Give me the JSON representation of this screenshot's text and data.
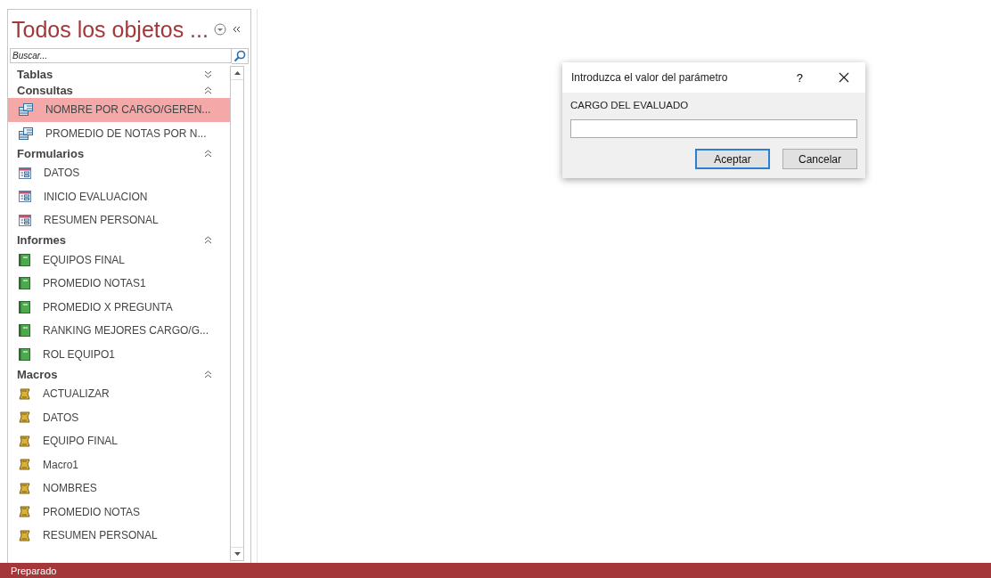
{
  "nav_pane": {
    "title": "Todos los objetos ...",
    "search": {
      "placeholder": "Buscar..."
    },
    "groups": [
      {
        "label": "Tablas",
        "expanded": false
      },
      {
        "label": "Consultas",
        "expanded": true,
        "items": [
          {
            "label": "NOMBRE POR CARGO/GEREN...",
            "kind": "query",
            "selected": true
          },
          {
            "label": "PROMEDIO DE NOTAS POR N...",
            "kind": "query",
            "selected": false
          }
        ]
      },
      {
        "label": "Formularios",
        "expanded": true,
        "items": [
          {
            "label": "DATOS",
            "kind": "form",
            "selected": false
          },
          {
            "label": "INICIO EVALUACION",
            "kind": "form",
            "selected": false
          },
          {
            "label": "RESUMEN PERSONAL",
            "kind": "form",
            "selected": false
          }
        ]
      },
      {
        "label": "Informes",
        "expanded": true,
        "items": [
          {
            "label": "EQUIPOS FINAL",
            "kind": "report",
            "selected": false
          },
          {
            "label": "PROMEDIO NOTAS1",
            "kind": "report",
            "selected": false
          },
          {
            "label": "PROMEDIO X PREGUNTA",
            "kind": "report",
            "selected": false
          },
          {
            "label": "RANKING MEJORES CARGO/G...",
            "kind": "report",
            "selected": false
          },
          {
            "label": "ROL EQUIPO1",
            "kind": "report",
            "selected": false
          }
        ]
      },
      {
        "label": "Macros",
        "expanded": true,
        "items": [
          {
            "label": "ACTUALIZAR",
            "kind": "macro",
            "selected": false
          },
          {
            "label": "DATOS",
            "kind": "macro",
            "selected": false
          },
          {
            "label": "EQUIPO FINAL",
            "kind": "macro",
            "selected": false
          },
          {
            "label": "Macro1",
            "kind": "macro",
            "selected": false
          },
          {
            "label": "NOMBRES",
            "kind": "macro",
            "selected": false
          },
          {
            "label": "PROMEDIO NOTAS",
            "kind": "macro",
            "selected": false
          },
          {
            "label": "RESUMEN PERSONAL",
            "kind": "macro",
            "selected": false
          }
        ]
      }
    ]
  },
  "dialog": {
    "title": "Introduzca el valor del parámetro",
    "help": "?",
    "prompt": "CARGO DEL EVALUADO",
    "buttons": [
      {
        "label": "Aceptar",
        "default": true
      },
      {
        "label": "Cancelar",
        "default": false
      }
    ]
  },
  "status_bar": {
    "text": "Preparado"
  }
}
